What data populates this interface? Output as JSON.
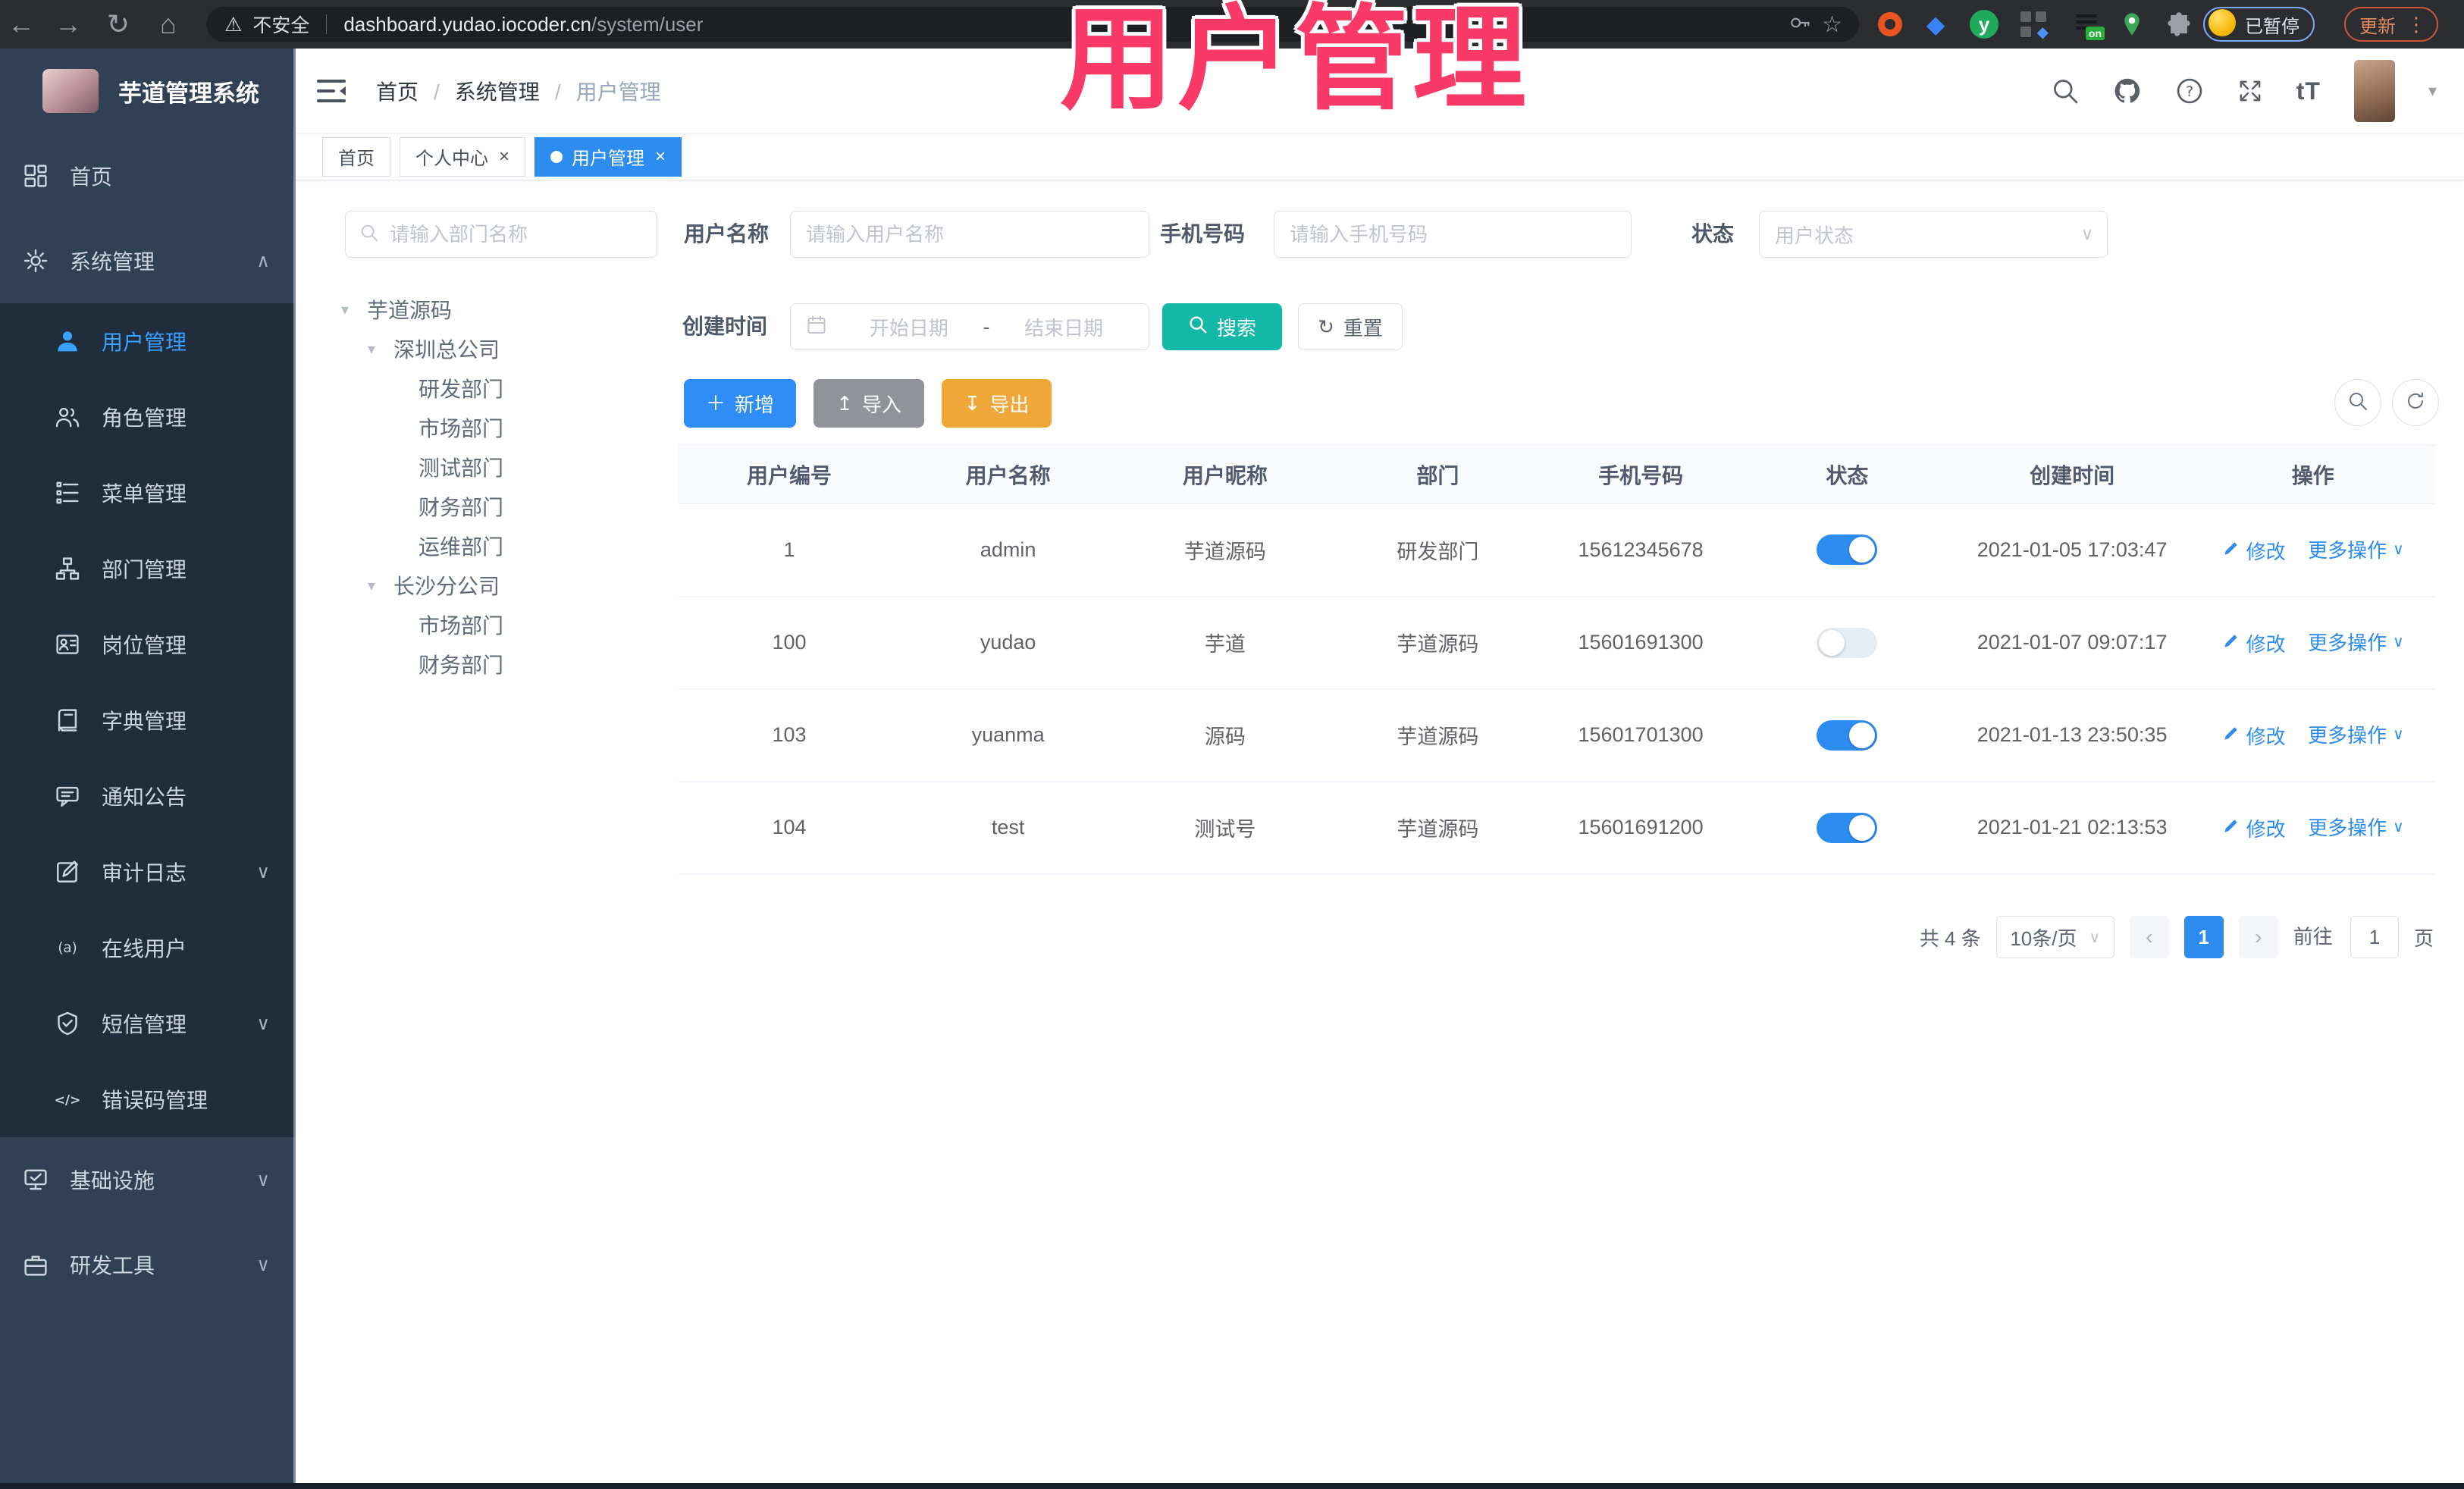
{
  "browser": {
    "security_label": "不安全",
    "url_host": "dashboard.yudao.iocoder.cn",
    "url_path": "/system/user",
    "paused_badge": "已暂停",
    "update_label": "更新",
    "extensions": [
      {
        "icon": "ubuntu-ext"
      },
      {
        "icon": "gem-ext"
      },
      {
        "icon": "yudao-ext"
      },
      {
        "icon": "grid-ext"
      },
      {
        "icon": "adblock-on-ext"
      },
      {
        "icon": "pin-ext"
      },
      {
        "icon": "puzzle-ext"
      }
    ]
  },
  "overlay": {
    "title": "用户管理"
  },
  "glyphs": {
    "back": "←",
    "forward": "→",
    "reload": "↻",
    "home": "⌂",
    "star": "☆",
    "dots": "⋮",
    "close": "×",
    "chevron_down": "∨",
    "caret_down": "▾",
    "dropdown_caret": "▾",
    "plus": "＋",
    "upload": "↥",
    "download": "↧",
    "font_size": "tT",
    "prev": "‹",
    "next": "›",
    "date_sep": "-"
  },
  "colors": {
    "accent_blue": "#2d8cf0",
    "search_teal": "#13b8a6",
    "export_amber": "#f0a73a",
    "import_grey": "#909399",
    "sidebar_bg": "#304156",
    "overlay_pink": "#fa3a66"
  },
  "sidebar": {
    "app_title": "芋道管理系统",
    "menu": [
      {
        "label": "首页",
        "icon": "dashboard-icon",
        "is_sub": false,
        "active": false,
        "arrow": ""
      },
      {
        "label": "系统管理",
        "icon": "gear-icon",
        "is_sub": false,
        "active": false,
        "arrow": "∧"
      },
      {
        "label": "用户管理",
        "icon": "user-icon",
        "is_sub": true,
        "active": true,
        "arrow": ""
      },
      {
        "label": "角色管理",
        "icon": "roles-icon",
        "is_sub": true,
        "active": false,
        "arrow": ""
      },
      {
        "label": "菜单管理",
        "icon": "menu-list-icon",
        "is_sub": true,
        "active": false,
        "arrow": ""
      },
      {
        "label": "部门管理",
        "icon": "org-tree-icon",
        "is_sub": true,
        "active": false,
        "arrow": ""
      },
      {
        "label": "岗位管理",
        "icon": "badge-icon",
        "is_sub": true,
        "active": false,
        "arrow": ""
      },
      {
        "label": "字典管理",
        "icon": "dictionary-icon",
        "is_sub": true,
        "active": false,
        "arrow": ""
      },
      {
        "label": "通知公告",
        "icon": "announcement-icon",
        "is_sub": true,
        "active": false,
        "arrow": ""
      },
      {
        "label": "审计日志",
        "icon": "audit-log-icon",
        "is_sub": true,
        "active": false,
        "arrow": "∨"
      },
      {
        "label": "在线用户",
        "icon": "online-user-icon",
        "is_sub": true,
        "active": false,
        "arrow": ""
      },
      {
        "label": "短信管理",
        "icon": "sms-icon",
        "is_sub": true,
        "active": false,
        "arrow": "∨"
      },
      {
        "label": "错误码管理",
        "icon": "error-code-icon",
        "is_sub": true,
        "active": false,
        "arrow": ""
      },
      {
        "label": "基础设施",
        "icon": "infrastructure-icon",
        "is_sub": false,
        "active": false,
        "arrow": "∨"
      },
      {
        "label": "研发工具",
        "icon": "dev-tools-icon",
        "is_sub": false,
        "active": false,
        "arrow": "∨"
      }
    ]
  },
  "header": {
    "breadcrumb": [
      "首页",
      "系统管理",
      "用户管理"
    ]
  },
  "tags": [
    {
      "label": "首页",
      "closable": false,
      "active": false
    },
    {
      "label": "个人中心",
      "closable": true,
      "active": false
    },
    {
      "label": "用户管理",
      "closable": true,
      "active": true
    }
  ],
  "dept": {
    "search_placeholder": "请输入部门名称",
    "tree": [
      {
        "label": "芋道源码",
        "level": 0,
        "expandable": true
      },
      {
        "label": "深圳总公司",
        "level": 1,
        "expandable": true
      },
      {
        "label": "研发部门",
        "level": 2,
        "expandable": false
      },
      {
        "label": "市场部门",
        "level": 2,
        "expandable": false
      },
      {
        "label": "测试部门",
        "level": 2,
        "expandable": false
      },
      {
        "label": "财务部门",
        "level": 2,
        "expandable": false
      },
      {
        "label": "运维部门",
        "level": 2,
        "expandable": false
      },
      {
        "label": "长沙分公司",
        "level": 1,
        "expandable": true
      },
      {
        "label": "市场部门",
        "level": 2,
        "expandable": false
      },
      {
        "label": "财务部门",
        "level": 2,
        "expandable": false
      }
    ]
  },
  "filters": {
    "username_label": "用户名称",
    "username_placeholder": "请输入用户名称",
    "mobile_label": "手机号码",
    "mobile_placeholder": "请输入手机号码",
    "status_label": "状态",
    "status_placeholder": "用户状态",
    "created_label": "创建时间",
    "date_start_placeholder": "开始日期",
    "date_end_placeholder": "结束日期",
    "search_label": "搜索",
    "reset_label": "重置"
  },
  "toolbar": {
    "add_label": "新增",
    "import_label": "导入",
    "export_label": "导出"
  },
  "table": {
    "columns": [
      "用户编号",
      "用户名称",
      "用户昵称",
      "部门",
      "手机号码",
      "状态",
      "创建时间",
      "操作"
    ],
    "action_edit": "修改",
    "action_more": "更多操作",
    "rows": [
      {
        "id": "1",
        "username": "admin",
        "nickname": "芋道源码",
        "dept": "研发部门",
        "mobile": "15612345678",
        "status_on": true,
        "created": "2021-01-05 17:03:47"
      },
      {
        "id": "100",
        "username": "yudao",
        "nickname": "芋道",
        "dept": "芋道源码",
        "mobile": "15601691300",
        "status_on": false,
        "created": "2021-01-07 09:07:17"
      },
      {
        "id": "103",
        "username": "yuanma",
        "nickname": "源码",
        "dept": "芋道源码",
        "mobile": "15601701300",
        "status_on": true,
        "created": "2021-01-13 23:50:35"
      },
      {
        "id": "104",
        "username": "test",
        "nickname": "测试号",
        "dept": "芋道源码",
        "mobile": "15601691200",
        "status_on": true,
        "created": "2021-01-21 02:13:53"
      }
    ]
  },
  "pagination": {
    "total_label": "共 4 条",
    "page_size_label": "10条/页",
    "current_page": "1",
    "goto_label": "前往",
    "goto_value": "1",
    "page_unit": "页"
  }
}
